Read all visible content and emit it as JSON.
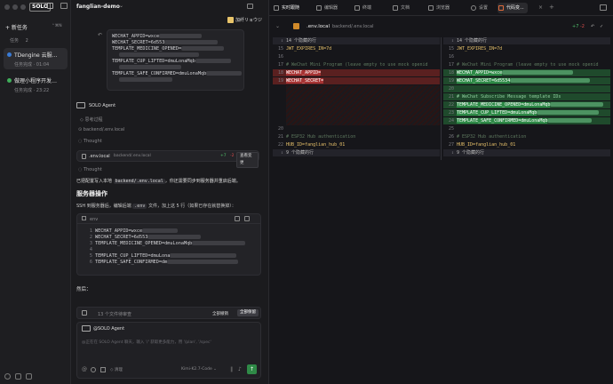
{
  "sidebar": {
    "logo": "SOLO",
    "new_task_label": "+ 新任务",
    "new_task_shortcut": "⌃⌘N",
    "tasks_header": "任务",
    "tasks_count": "2",
    "tasks": [
      {
        "title": "TDengine 云服…",
        "status": "任务完成 · 01:04",
        "dot": "#3a7bd5"
      },
      {
        "title": "做理小程序开发…",
        "status": "任务完成 · 23:22",
        "dot": "#3fae5a"
      }
    ]
  },
  "chat": {
    "project": "fanglian-demo",
    "user_name": "加纤リョウジ",
    "user_code": [
      "WECHAT_APPID=wxce",
      "WECHAT_SECRET=6d553",
      "TEMPLATE_MEDICINE_OPENED=",
      "TEMPLATE_CUP_LIFTED=dmuLonaMqb",
      "TEMPLATE_SAFE_CONFIRMED=dmuLonaMqb"
    ],
    "agent_name": "SOLO Agent",
    "thinking_label": "思考过程",
    "file_ref": "backend/.env.local",
    "thought_label_1": "Thought",
    "edit_file": ".env.local",
    "edit_path": "backend/.env.local",
    "edit_added": "+7",
    "edit_removed": "-2",
    "view_changes_label": "查看变更",
    "thought_label_2": "Thought",
    "summary_prefix": "已把配置写入本地",
    "summary_code": "backend/.env.local",
    "summary_suffix": "，你还需要同步到服务器并重启后端。",
    "section_heading": "服务器操作",
    "section_text_1": "SSH 到服务器后，编辑后端",
    "section_code": ".env",
    "section_text_2": "文件，加上这 5 行（如果已存在就替换掉）：",
    "code_lang": "env",
    "code_lines": [
      {
        "n": "1",
        "text": "WECHAT_APPID=wxce"
      },
      {
        "n": "2",
        "text": "WECHAT_SECRET=6d553"
      },
      {
        "n": "3",
        "text": "TEMPLATE_MEDICINE_OPENED=dmuLonaMqb"
      },
      {
        "n": "4",
        "text": ""
      },
      {
        "n": "5",
        "text": "TEMPLATE_CUP_LIFTED=dmuLona"
      },
      {
        "n": "6",
        "text": "TEMPLATE_SAFE_CONFIRMED=dm"
      }
    ],
    "then_label": "然后：",
    "pending_label": "13 个文件待审查",
    "reject_all_label": "全部撤销",
    "accept_all_label": "全部保留",
    "input_agent_label": "@SOLO Agent",
    "input_placeholder": "@正在在 SOLO Agent 聊天，输入 '/' 获取更多能力，用 '/plan', '/spec'",
    "clear_label": "清理",
    "model_label": "Kimi-K2.7-Code"
  },
  "right": {
    "tabs": [
      {
        "label": "实时跟随",
        "active": false
      },
      {
        "label": "编辑器",
        "active": false
      },
      {
        "label": "终端",
        "active": false
      },
      {
        "label": "文档",
        "active": false
      },
      {
        "label": "浏览器",
        "active": false
      },
      {
        "label": "设置",
        "active": false
      },
      {
        "label": "代码变...",
        "active": true
      }
    ],
    "file_name": ".env.local",
    "file_path": "backend/.env.local",
    "added": "+7",
    "removed": "-2",
    "hidden_top": "14 个隐藏的行",
    "hidden_bottom": "9 个隐藏的行",
    "left_lines": [
      {
        "n": "15",
        "text": "JWT_EXPIRES_IN=7d",
        "kind": "normal"
      },
      {
        "n": "16",
        "text": "",
        "kind": "normal"
      },
      {
        "n": "17",
        "text": "# WeChat Mini Program (leave empty to use mock openid",
        "kind": "comment"
      },
      {
        "n": "18",
        "text": "WECHAT_APPID=",
        "kind": "removed"
      },
      {
        "n": "19",
        "text": "WECHAT_SECRET=",
        "kind": "removed"
      },
      {
        "n": "20",
        "text": "",
        "kind": "normal"
      },
      {
        "n": "21",
        "text": "# ESP32 Hub authentication",
        "kind": "comment"
      },
      {
        "n": "22",
        "text": "HUB_ID=fanglian_hub_01",
        "kind": "normal"
      }
    ],
    "right_lines": [
      {
        "n": "15",
        "text": "JWT_EXPIRES_IN=7d",
        "kind": "normal"
      },
      {
        "n": "16",
        "text": "",
        "kind": "normal"
      },
      {
        "n": "17",
        "text": "# WeChat Mini Program (leave empty to use mock openid",
        "kind": "comment"
      },
      {
        "n": "18",
        "text": "WECHAT_APPID=wxce",
        "kind": "added"
      },
      {
        "n": "19",
        "text": "WECHAT_SECRET=6d5534",
        "kind": "added"
      },
      {
        "n": "20",
        "text": "",
        "kind": "addedblank"
      },
      {
        "n": "21",
        "text": "# WeChat Subscribe Message template IDs",
        "kind": "addedcomment"
      },
      {
        "n": "22",
        "text": "TEMPLATE_MEDICINE_OPENED=dmuLonaMqb",
        "kind": "added"
      },
      {
        "n": "23",
        "text": "TEMPLATE_CUP_LIFTED=dmuLonaMqb",
        "kind": "added"
      },
      {
        "n": "24",
        "text": "TEMPLATE_SAFE_CONFIRMED=dmuLonaMqb",
        "kind": "added"
      },
      {
        "n": "25",
        "text": "",
        "kind": "normal"
      },
      {
        "n": "26",
        "text": "# ESP32 Hub authentication",
        "kind": "comment"
      },
      {
        "n": "27",
        "text": "HUB_ID=fanglian_hub_01",
        "kind": "normal"
      }
    ]
  }
}
